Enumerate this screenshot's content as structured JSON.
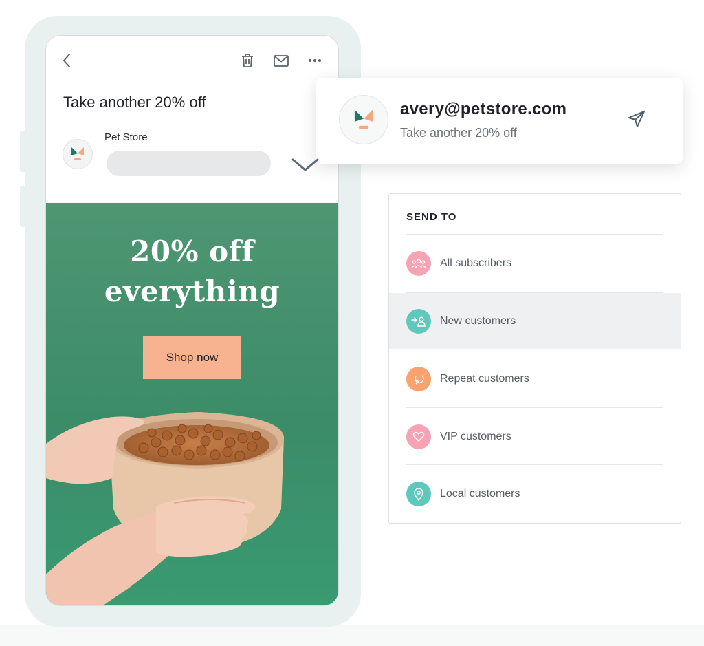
{
  "email": {
    "subject": "Take another 20% off",
    "sender_name": "Pet Store",
    "promo_title_line1": "20% off",
    "promo_title_line2": "everything",
    "cta_label": "Shop now"
  },
  "sender_card": {
    "email": "avery@petstore.com",
    "subject": "Take another 20% off"
  },
  "send_to": {
    "heading": "SEND TO",
    "audiences": [
      {
        "label": "All subscribers",
        "icon": "group-icon",
        "color": "#f7a3b4",
        "selected": false
      },
      {
        "label": "New customers",
        "icon": "user-arrow-icon",
        "color": "#5fc8bd",
        "selected": true
      },
      {
        "label": "Repeat customers",
        "icon": "repeat-arrow-icon",
        "color": "#fca26f",
        "selected": false
      },
      {
        "label": "VIP customers",
        "icon": "heart-icon",
        "color": "#f7a3b4",
        "selected": false
      },
      {
        "label": "Local customers",
        "icon": "map-pin-icon",
        "color": "#5fc8bd",
        "selected": false
      }
    ]
  },
  "colors": {
    "promo_green": "#3f8f6b",
    "cta_peach": "#f7b28f",
    "logo_teal": "#1c7a66",
    "logo_peach": "#f4a882"
  }
}
